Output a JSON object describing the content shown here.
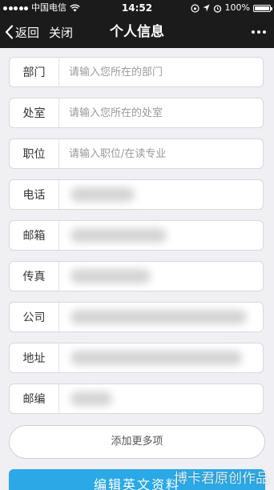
{
  "status_bar": {
    "carrier": "中国电信",
    "time": "14:52",
    "battery": "100%",
    "battery_level": 1.0,
    "signal_bars": 5
  },
  "nav": {
    "back_label": "返回",
    "close_label": "关闭",
    "title": "个人信息"
  },
  "form": {
    "rows": [
      {
        "label": "部门",
        "placeholder": "请输入您所在的部门",
        "value": ""
      },
      {
        "label": "处室",
        "placeholder": "请输入您所在的处室",
        "value": ""
      },
      {
        "label": "职位",
        "placeholder": "请输入职位/在读专业",
        "value": ""
      },
      {
        "label": "电话",
        "placeholder": "",
        "value": ""
      },
      {
        "label": "邮箱",
        "placeholder": "",
        "value": ""
      },
      {
        "label": "传真",
        "placeholder": "",
        "value": ""
      },
      {
        "label": "公司",
        "placeholder": "",
        "value": ""
      },
      {
        "label": "地址",
        "placeholder": "",
        "value": ""
      },
      {
        "label": "邮编",
        "placeholder": "",
        "value": ""
      }
    ]
  },
  "add_more_label": "添加更多项",
  "edit_english_label": "编辑英文资料",
  "watermark": "博卡君原创作品",
  "colors": {
    "nav_background": "#1b1b1b",
    "page_background": "#efeff4",
    "primary_button": "#2aa9e6"
  }
}
